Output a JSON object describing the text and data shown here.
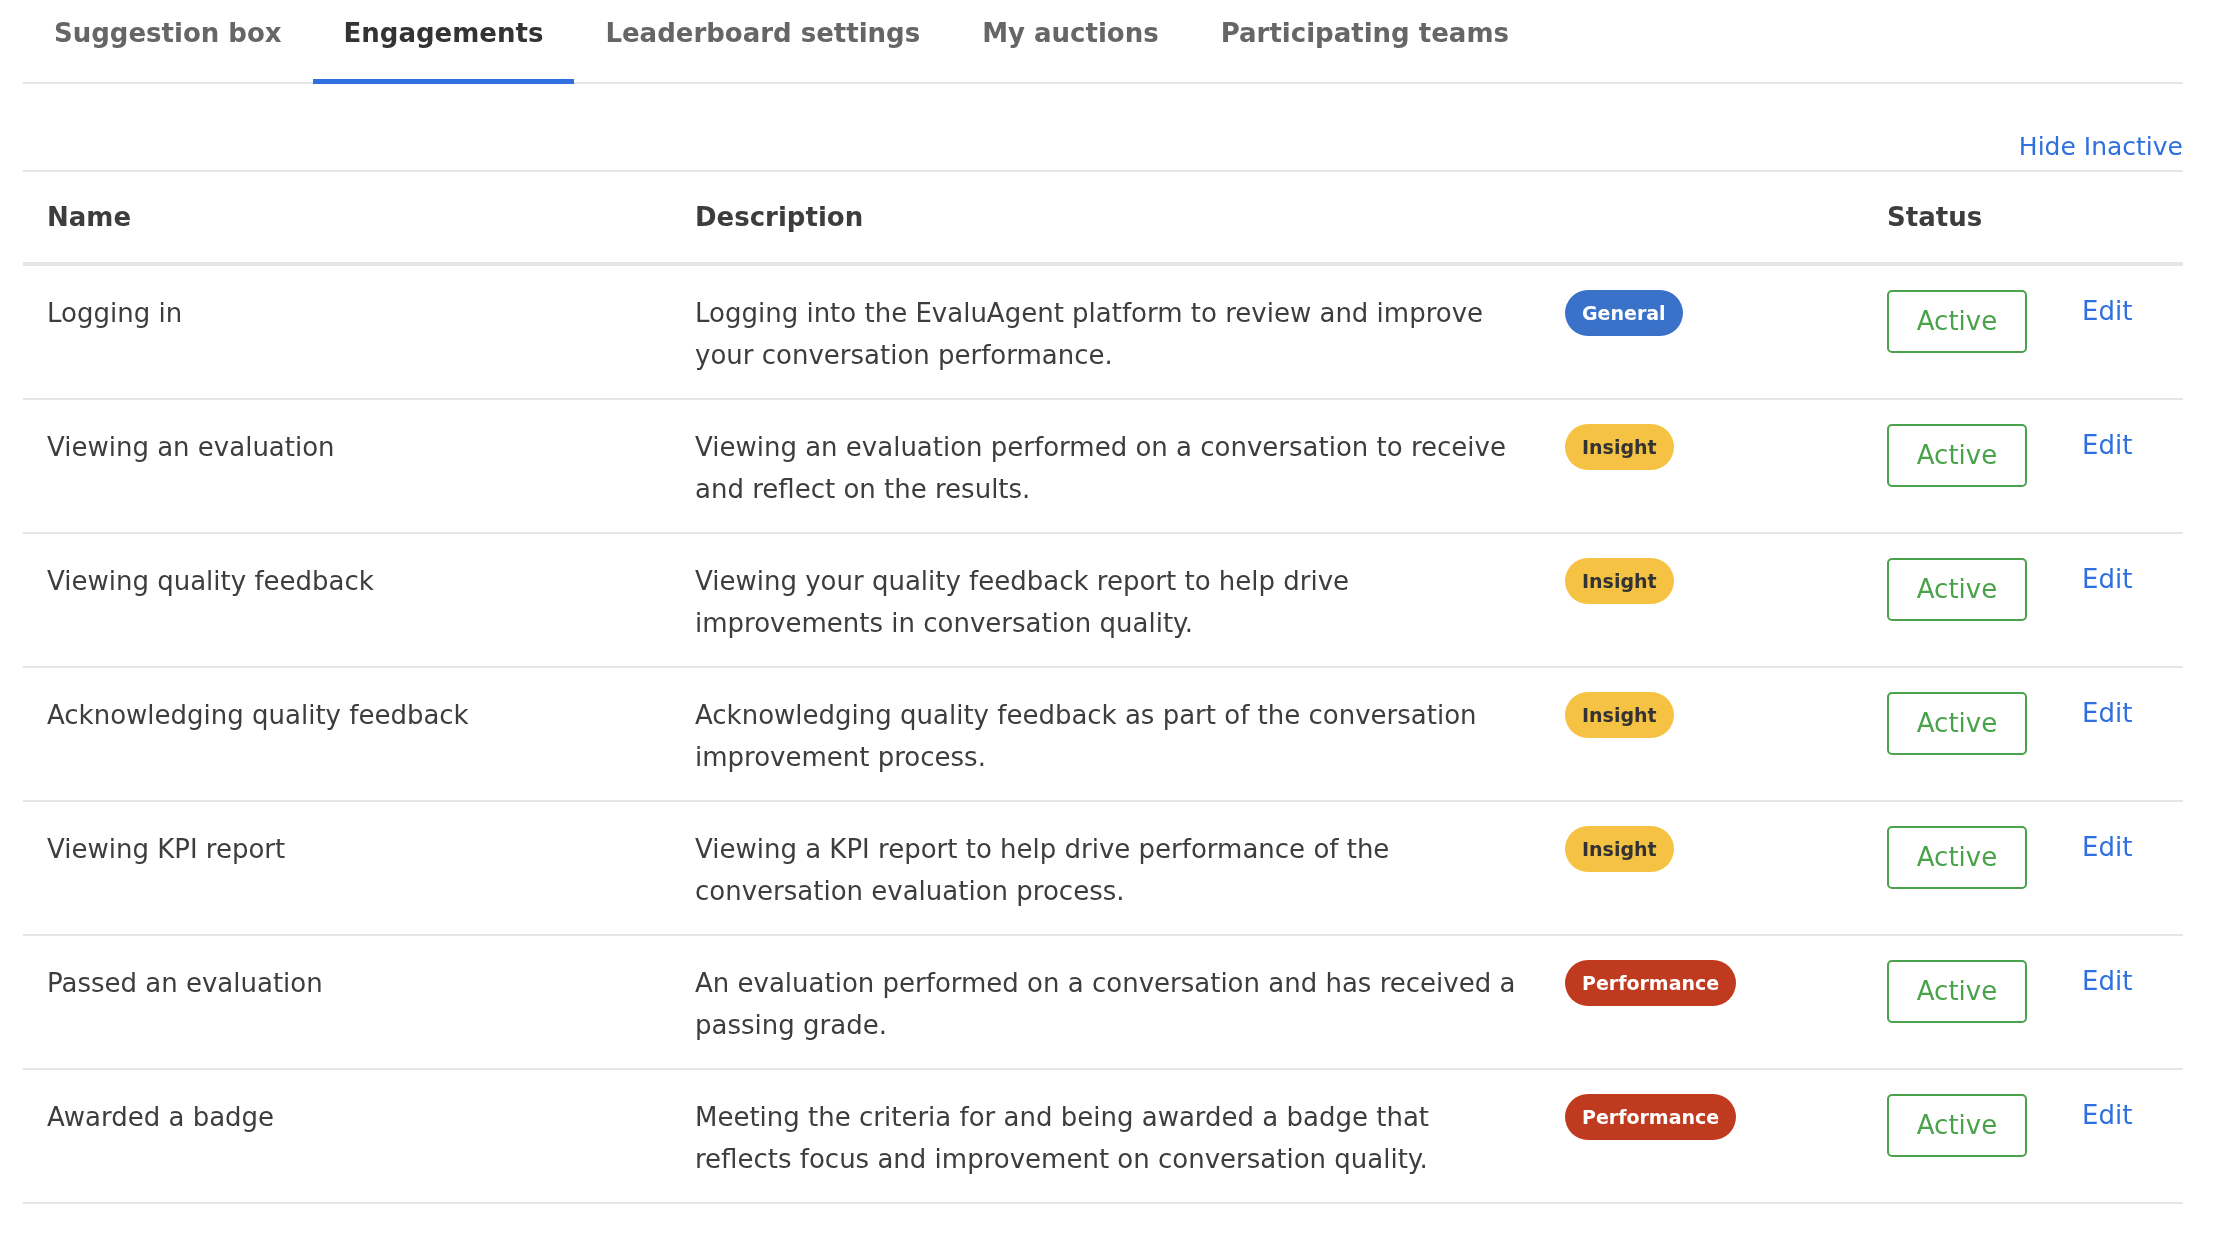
{
  "tabs": [
    {
      "label": "Suggestion box",
      "selected": false
    },
    {
      "label": "Engagements",
      "selected": true
    },
    {
      "label": "Leaderboard settings",
      "selected": false
    },
    {
      "label": "My auctions",
      "selected": false
    },
    {
      "label": "Participating teams",
      "selected": false
    }
  ],
  "hide_inactive_link": "Hide Inactive",
  "table": {
    "columns": [
      "Name",
      "Description",
      "Status"
    ],
    "rows": [
      {
        "name": "Logging in",
        "description": "Logging into the EvaluAgent platform to review and improve your conversation performance.",
        "tag": {
          "label": "General",
          "color": "#3a72c9"
        },
        "status": "Active",
        "action": "Edit"
      },
      {
        "name": "Viewing an evaluation",
        "description": "Viewing an evaluation performed on a conversation to receive and reflect on the results.",
        "tag": {
          "label": "Insight",
          "color": "#f5c243"
        },
        "status": "Active",
        "action": "Edit"
      },
      {
        "name": "Viewing quality feedback",
        "description": "Viewing your quality feedback report to help drive improvements in conversation quality.",
        "tag": {
          "label": "Insight",
          "color": "#f5c243"
        },
        "status": "Active",
        "action": "Edit"
      },
      {
        "name": "Acknowledging quality feedback",
        "description": "Acknowledging quality feedback as part of the conversation improvement process.",
        "tag": {
          "label": "Insight",
          "color": "#f5c243"
        },
        "status": "Active",
        "action": "Edit"
      },
      {
        "name": "Viewing KPI report",
        "description": "Viewing a KPI report to help drive performance of the conversation evaluation process.",
        "tag": {
          "label": "Insight",
          "color": "#f5c243"
        },
        "status": "Active",
        "action": "Edit"
      },
      {
        "name": "Passed an evaluation",
        "description": "An evaluation performed on a conversation and has received a passing grade.",
        "tag": {
          "label": "Performance",
          "color": "#bf3a1e"
        },
        "status": "Active",
        "action": "Edit"
      },
      {
        "name": "Awarded a badge",
        "description": "Meeting the criteria for and being awarded a badge that reflects focus and improvement on conversation quality.",
        "tag": {
          "label": "Performance",
          "color": "#bf3a1e"
        },
        "status": "Active",
        "action": "Edit"
      }
    ]
  }
}
